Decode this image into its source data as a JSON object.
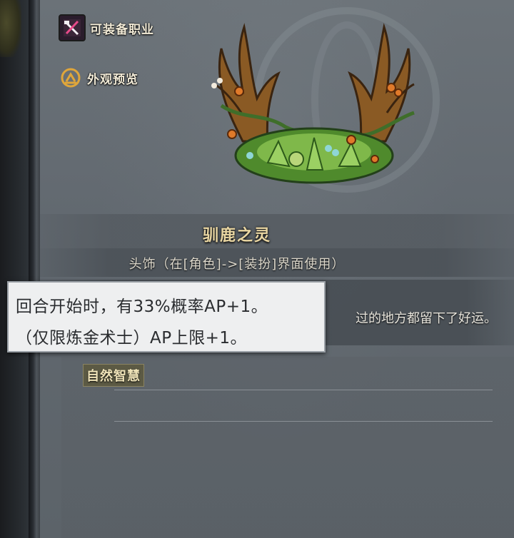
{
  "side_menu": {
    "equip_class_label": "可装备职业",
    "equip_class_icon": "crossed-tools-icon",
    "appearance_label": "外观预览",
    "appearance_icon": "hanger-icon"
  },
  "item": {
    "name": "驯鹿之灵",
    "type_text": "头饰（在[角色]->[装扮]界面使用）",
    "flavor_fragment": "过的地方都留下了好运。",
    "tag": "自然智慧"
  },
  "tooltip": {
    "line1": "回合开始时，有33%概率AP+1。",
    "line2": "（仅限炼金术士）AP上限+1。"
  },
  "colors": {
    "name_gold": "#e9d6a2",
    "panel_gray": "#626970",
    "tooltip_bg": "#eeeff0"
  }
}
